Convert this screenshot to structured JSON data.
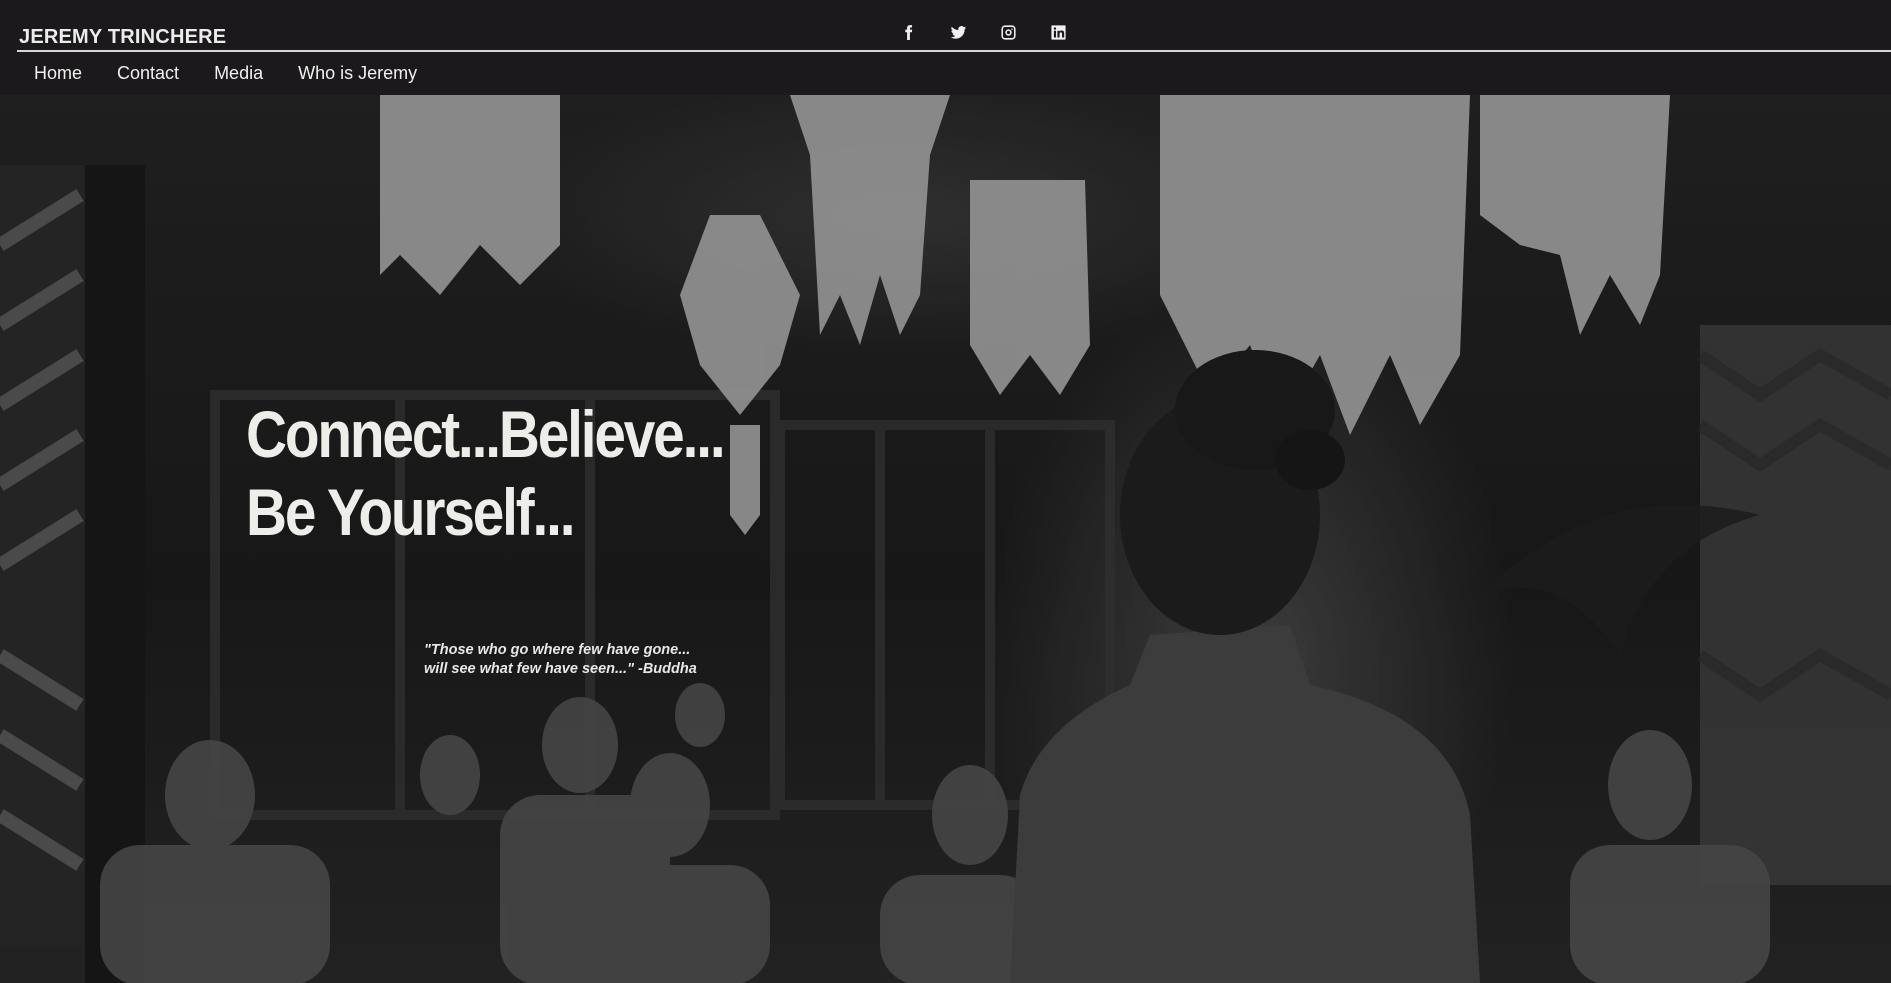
{
  "header": {
    "brand": "JEREMY TRINCHERE",
    "social_icons": [
      "facebook-icon",
      "twitter-icon",
      "instagram-icon",
      "linkedin-icon"
    ]
  },
  "nav": {
    "items": [
      {
        "label": "Home"
      },
      {
        "label": "Contact"
      },
      {
        "label": "Media"
      },
      {
        "label": "Who is Jeremy"
      }
    ]
  },
  "hero": {
    "headline_line1": "Connect...Believe...",
    "headline_line2": "Be Yourself...",
    "quote_line1": "\"Those who go where few have gone...",
    "quote_line2": "will see what few have seen...\" -Buddha"
  },
  "colors": {
    "header_background": "#1b191b",
    "header_text": "#ececec",
    "headline_text": "#ededea"
  }
}
